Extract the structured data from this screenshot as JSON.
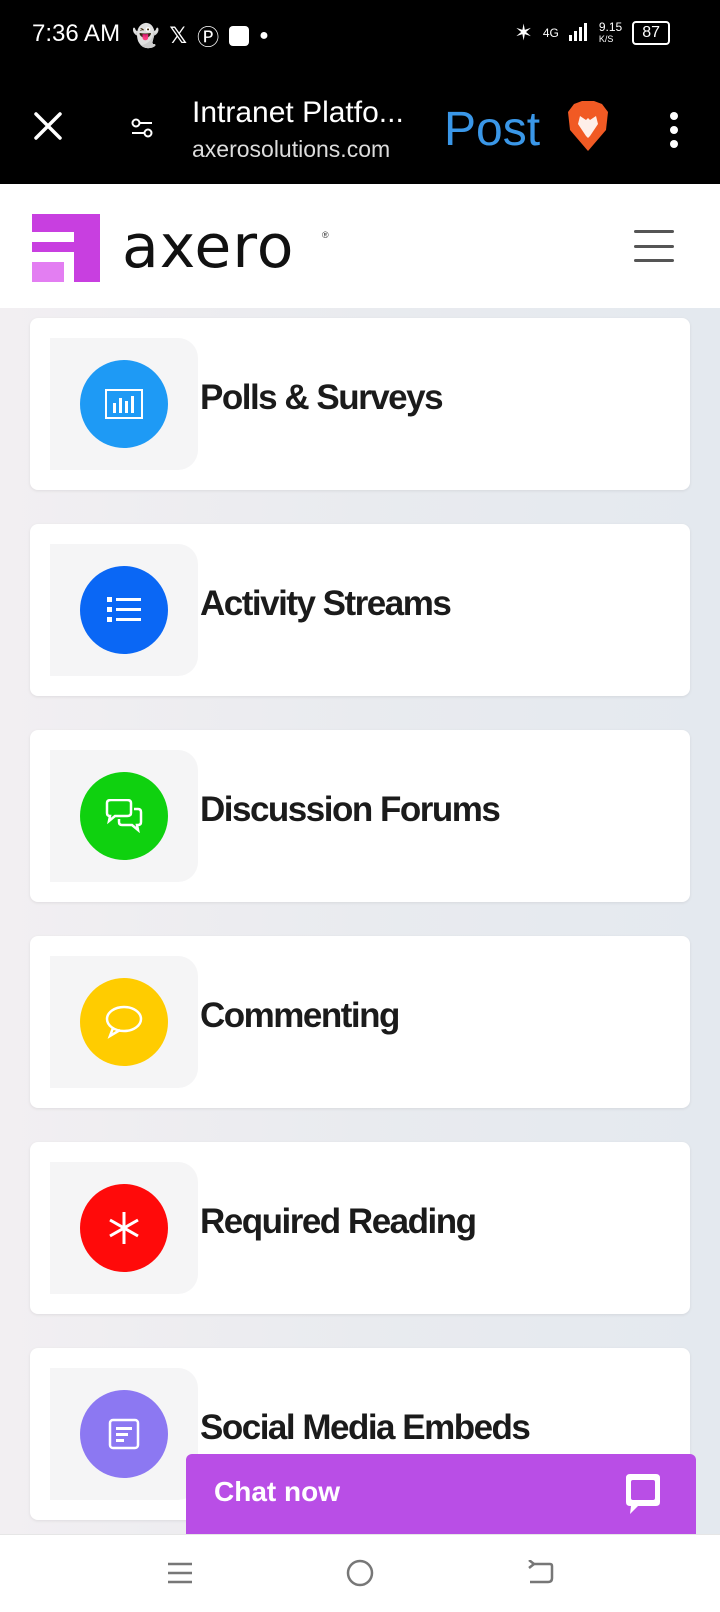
{
  "status_bar": {
    "time": "7:36 AM",
    "network": "4G",
    "speed": "9.15",
    "speed_unit": "K/S",
    "battery": "87"
  },
  "browser": {
    "page_title": "Intranet Platfo...",
    "url": "axerosolutions.com",
    "post_label": "Post"
  },
  "site": {
    "logo_text": "axero",
    "logo_reg": "®"
  },
  "cards": [
    {
      "label": "Polls & Surveys",
      "color": "#1e9af5",
      "icon": "bar-chart-icon"
    },
    {
      "label": "Activity Streams",
      "color": "#0a67f5",
      "icon": "list-icon"
    },
    {
      "label": "Discussion Forums",
      "color": "#0fd10f",
      "icon": "chat-bubbles-icon"
    },
    {
      "label": "Commenting",
      "color": "#ffcc00",
      "icon": "comment-icon"
    },
    {
      "label": "Required Reading",
      "color": "#ff0a0a",
      "icon": "asterisk-icon"
    },
    {
      "label": "Social Media Embeds",
      "color": "#8c78f2",
      "icon": "document-icon"
    }
  ],
  "chat": {
    "label": "Chat now",
    "color": "#b94ee6"
  },
  "colors": {
    "accent": "#3a97e8",
    "brand": "#c83fe0"
  }
}
